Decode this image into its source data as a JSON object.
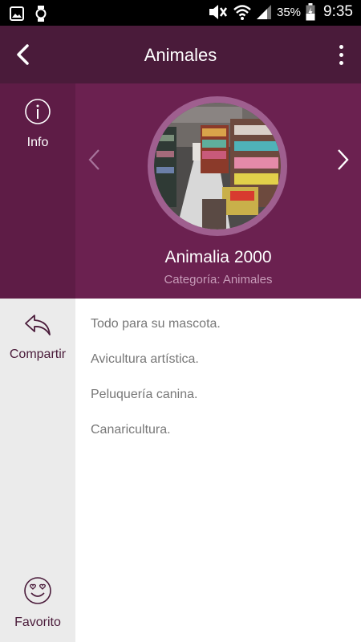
{
  "status_bar": {
    "battery": "35%",
    "time": "9:35",
    "icons": [
      "image-icon",
      "watch-icon",
      "mute-icon",
      "wifi-icon",
      "signal-icon",
      "battery-icon"
    ]
  },
  "appbar": {
    "title": "Animales",
    "back_icon": "chevron-left-icon",
    "menu_icon": "more-vertical-icon"
  },
  "hero": {
    "info_label": "Info",
    "name": "Animalia 2000",
    "category": "Categoría: Animales",
    "photo_alt": "shop-interior-photo"
  },
  "rail": {
    "share_label": "Compartir",
    "favorite_label": "Favorito"
  },
  "content": {
    "lines": [
      "Todo para su mascota.",
      "Avicultura artística.",
      "Peluquería canina.",
      "Canaricultura."
    ]
  },
  "colors": {
    "appbar": "#4a1b3a",
    "hero": "#6b2150",
    "accent_text": "#4a1b3a"
  }
}
